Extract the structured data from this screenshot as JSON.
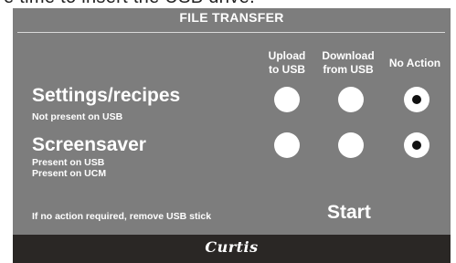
{
  "top_caption": "e time to insert the USB drive.",
  "panel": {
    "title": "FILE TRANSFER",
    "columns": [
      {
        "line1": "Upload",
        "line2": "to USB"
      },
      {
        "line1": "Download",
        "line2": "from USB"
      },
      {
        "line1": "No Action",
        "line2": ""
      }
    ],
    "rows": [
      {
        "title": "Settings/recipes",
        "subtitles": [
          "Not present on USB"
        ],
        "selected": "No Action"
      },
      {
        "title": "Screensaver",
        "subtitles": [
          "Present on USB",
          "Present on UCM"
        ],
        "selected": "No Action"
      }
    ],
    "hint": "If no action required, remove USB stick",
    "start_label": "Start"
  },
  "brand": {
    "logo_text": "Curtis"
  }
}
